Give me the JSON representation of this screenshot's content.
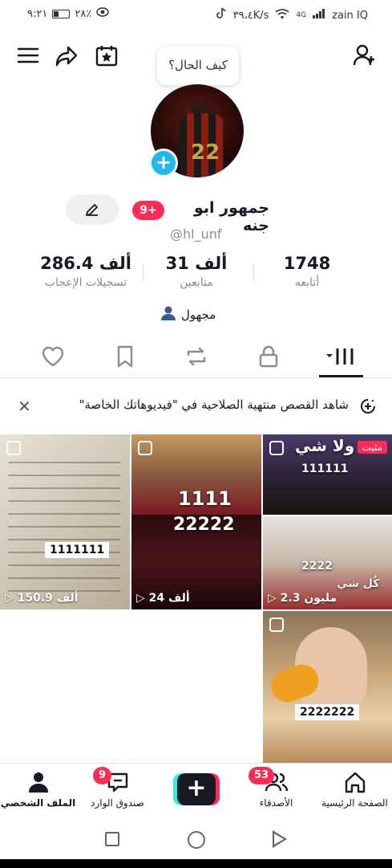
{
  "status_bar": {
    "time": "٩:٢١",
    "battery": "٢٨٪",
    "speed": "٣٩،٤K/s",
    "network": "4G",
    "carrier": "zain IQ"
  },
  "header": {
    "bubble_text": "كيف الحال؟"
  },
  "profile": {
    "display_name": "جمهور ابو جنه",
    "notif_badge": "9+",
    "username": "@hl_unf",
    "jersey_number": "22",
    "stats": [
      {
        "value": "1748",
        "label": "أتابعه"
      },
      {
        "value": "31 ألف",
        "label": "متابعين"
      },
      {
        "value": "286.4 ألف",
        "label": "تسجيلات الإعجاب"
      }
    ],
    "bio": "مجهول"
  },
  "banner": {
    "text": "شاهد القصص منتهية الصلاحية في \"فيديوهاتك الخاصة\""
  },
  "videos": [
    {
      "views": "2.3 مليون",
      "pinned_label": "مثبت",
      "labels": [
        "ولا شي",
        "111111",
        "2222",
        "كُل شي"
      ]
    },
    {
      "views": "24 ألف",
      "labels": [
        "1111",
        "22222"
      ]
    },
    {
      "views": "150.9 ألف",
      "labels": [
        "1111111"
      ]
    },
    {
      "views": "",
      "labels": [
        "2222222"
      ]
    }
  ],
  "bottom_nav": {
    "home": "الصفحة الرئيسية",
    "friends": "الأصدقاء",
    "friends_badge": "53",
    "inbox": "صندوق الوارد",
    "inbox_badge": "9",
    "profile": "الملف الشخصي"
  },
  "colors": {
    "accent_red": "#fe2c55",
    "accent_cyan": "#25f4ee",
    "text": "#161823",
    "muted": "#8a8b91"
  }
}
